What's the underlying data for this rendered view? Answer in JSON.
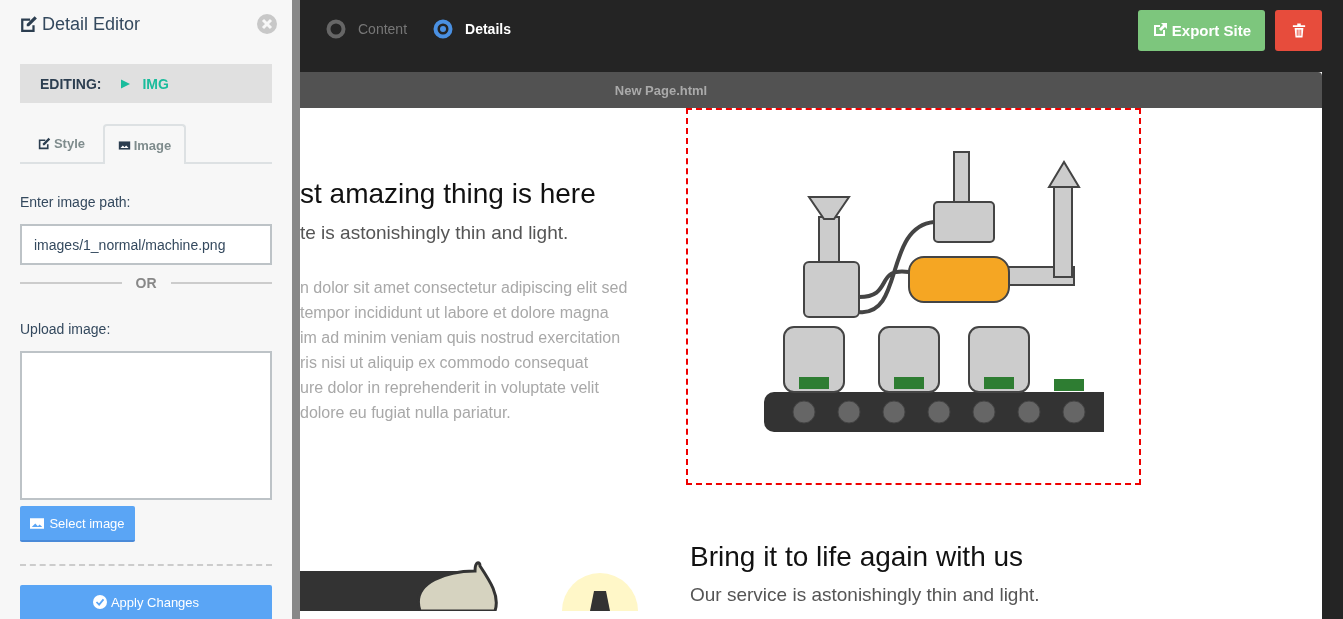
{
  "panel": {
    "title": "Detail Editor",
    "editing_label": "EDITING:",
    "editing_element": "IMG",
    "tabs": [
      {
        "label": "Style",
        "kind": "style",
        "selected": false
      },
      {
        "label": "Image",
        "kind": "image",
        "selected": true
      }
    ],
    "path_label": "Enter image path:",
    "path_value": "images/1_normal/machine.png",
    "divider": "OR",
    "upload_label": "Upload image:",
    "select_button": "Select image",
    "apply_button": "Apply Changes"
  },
  "steps": [
    {
      "label": "Content",
      "selected": false
    },
    {
      "label": "Details",
      "selected": true
    }
  ],
  "export_button": "Export Site",
  "preview": {
    "title": "New Page.html",
    "image_selected": true,
    "hero": {
      "heading": "st amazing thing is here",
      "subheading": "te is astonishingly thin and light.",
      "body_lines": [
        "n dolor sit amet consectetur adipiscing elit sed",
        "tempor incididunt ut labore et dolore magna",
        "im ad minim veniam quis nostrud exercitation",
        "ris nisi ut aliquip ex commodo consequat",
        "ure dolor in reprehenderit in voluptate velit",
        "dolore eu fugiat nulla pariatur."
      ]
    },
    "second": {
      "heading": "Bring it to life again with us",
      "subheading": "Our service is astonishingly thin and light."
    }
  }
}
